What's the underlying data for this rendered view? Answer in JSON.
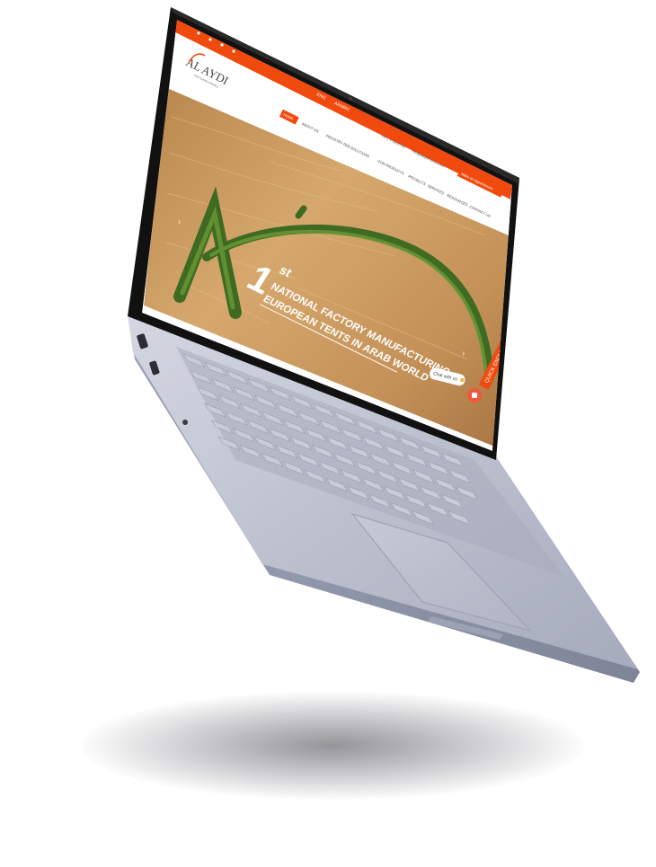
{
  "website": {
    "logo_text": "AL AYDI",
    "logo_tagline": "TENTS AND SHADES",
    "lang_en": "ENG",
    "lang_ar": "ARABIC",
    "phone": "+971 6 5315733",
    "email": "info@alaydi-tents.com",
    "appointment_button": "Make an Appointment",
    "nav": [
      "HOME",
      "ABOUT US",
      "INDUSTRY FEB SOLUTIONS",
      "OUR PRODUCTS",
      "PROJECTS",
      "SERVICES",
      "RESOURCES",
      "CONTACT US"
    ],
    "hero": {
      "ordinal": "1",
      "ordinal_suffix": "st",
      "line1": "NATIONAL FACTORY MANUFACTURING",
      "line2": "EUROPEAN TENTS IN ARAB WORLD"
    },
    "chat_label": "Chat with us",
    "quick_enquiry": "QUICK ENQUIRY"
  },
  "colors": {
    "brand_orange": "#f04a0e",
    "laptop_body": "#b8bdcd",
    "laptop_dark": "#8d93a6",
    "screen_bezel": "#151515",
    "sand": "#c8965a"
  }
}
